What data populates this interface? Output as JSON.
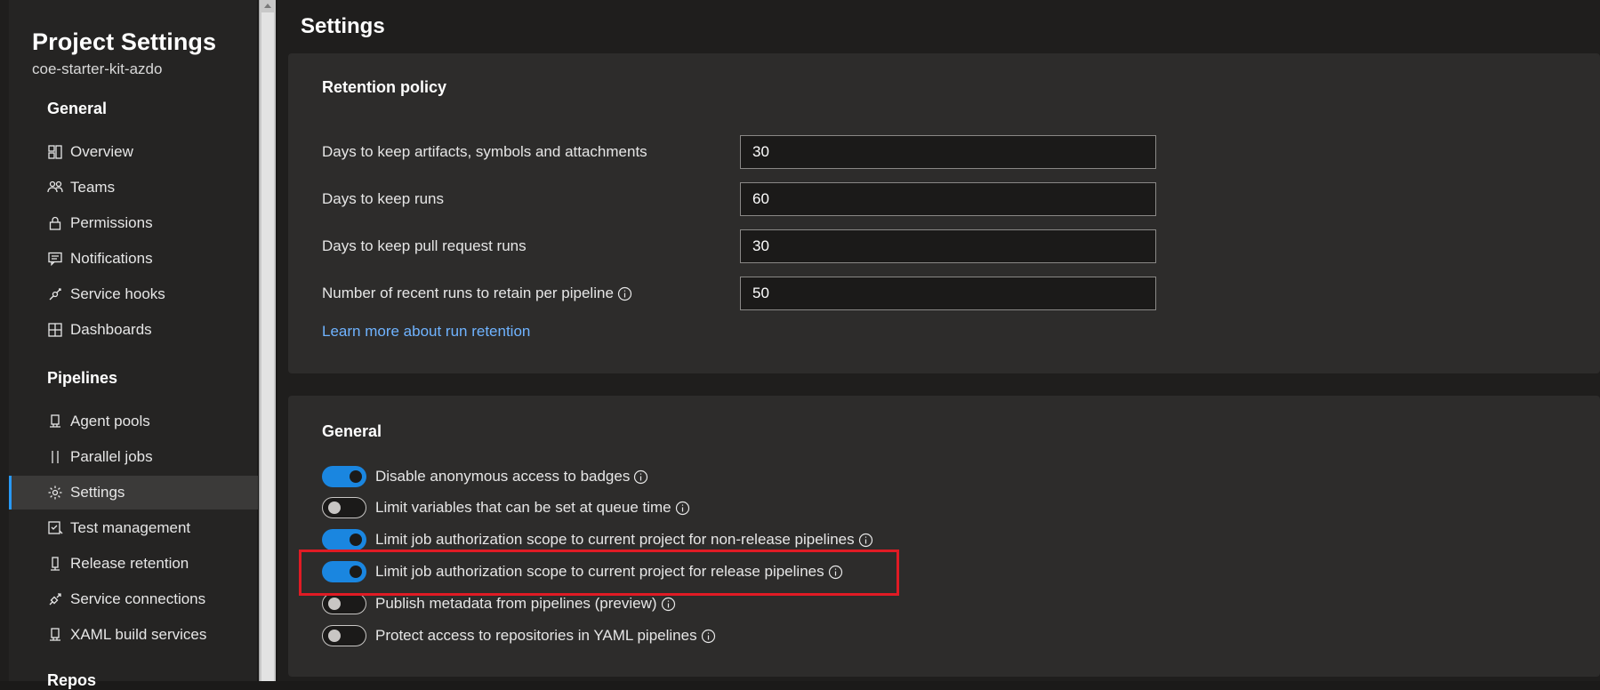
{
  "sidebar": {
    "title": "Project Settings",
    "subtitle": "coe-starter-kit-azdo",
    "sections": [
      {
        "header": "General",
        "items": [
          {
            "label": "Overview",
            "icon": "overview-icon"
          },
          {
            "label": "Teams",
            "icon": "teams-icon"
          },
          {
            "label": "Permissions",
            "icon": "lock-icon"
          },
          {
            "label": "Notifications",
            "icon": "notifications-icon"
          },
          {
            "label": "Service hooks",
            "icon": "service-hooks-icon"
          },
          {
            "label": "Dashboards",
            "icon": "dashboards-icon"
          }
        ]
      },
      {
        "header": "Pipelines",
        "items": [
          {
            "label": "Agent pools",
            "icon": "agent-pools-icon"
          },
          {
            "label": "Parallel jobs",
            "icon": "parallel-jobs-icon"
          },
          {
            "label": "Settings",
            "icon": "gear-icon",
            "selected": true
          },
          {
            "label": "Test management",
            "icon": "test-management-icon"
          },
          {
            "label": "Release retention",
            "icon": "release-retention-icon"
          },
          {
            "label": "Service connections",
            "icon": "service-connections-icon"
          },
          {
            "label": "XAML build services",
            "icon": "xaml-build-icon"
          }
        ]
      },
      {
        "header": "Repos",
        "items": []
      }
    ]
  },
  "main": {
    "title": "Settings",
    "retention": {
      "title": "Retention policy",
      "fields": [
        {
          "label": "Days to keep artifacts, symbols and attachments",
          "value": "30",
          "info": false
        },
        {
          "label": "Days to keep runs",
          "value": "60",
          "info": false
        },
        {
          "label": "Days to keep pull request runs",
          "value": "30",
          "info": false
        },
        {
          "label": "Number of recent runs to retain per pipeline",
          "value": "50",
          "info": true
        }
      ],
      "link": "Learn more about run retention"
    },
    "general": {
      "title": "General",
      "toggles": [
        {
          "label": "Disable anonymous access to badges",
          "on": true
        },
        {
          "label": "Limit variables that can be set at queue time",
          "on": false
        },
        {
          "label": "Limit job authorization scope to current project for non-release pipelines",
          "on": true
        },
        {
          "label": "Limit job authorization scope to current project for release pipelines",
          "on": true,
          "highlighted": true
        },
        {
          "label": "Publish metadata from pipelines (preview)",
          "on": false
        },
        {
          "label": "Protect access to repositories in YAML pipelines",
          "on": false
        }
      ]
    }
  },
  "colors": {
    "accent": "#1a86e0",
    "highlight": "#e01b24",
    "link": "#6fb3ff"
  }
}
